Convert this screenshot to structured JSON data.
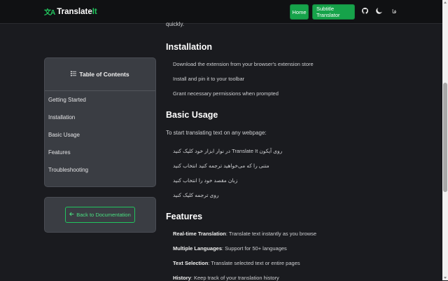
{
  "navbar": {
    "brand_icon": "文A",
    "brand_prefix": "Translate",
    "brand_suffix": "It",
    "home_label": "Home",
    "subtitle_label": "Subtitle Translator",
    "github_icon": "github-icon",
    "theme_icon": "moon-icon",
    "language_label": "فا"
  },
  "toc": {
    "title": "Table of Contents",
    "items": [
      "Getting Started",
      "Installation",
      "Basic Usage",
      "Features",
      "Troubleshooting"
    ]
  },
  "back_label": "Back to Documentation",
  "content": {
    "partial_text": "quickly.",
    "installation": {
      "heading": "Installation",
      "steps": [
        "Download the extension from your browser's extension store",
        "Install and pin it to your toolbar",
        "Grant necessary permissions when prompted"
      ]
    },
    "basic_usage": {
      "heading": "Basic Usage",
      "intro": "To start translating text on any webpage:",
      "steps": [
        "روی آیکون Translate It در نوار ابزار خود کلیک کنید",
        "متنی را که می‌خواهید ترجمه کنید انتخاب کنید",
        "زبان مقصد خود را انتخاب کنید",
        "روی ترجمه کلیک کنید"
      ]
    },
    "features": {
      "heading": "Features",
      "items": [
        {
          "name": "Real-time Translation",
          "desc": ": Translate text instantly as you browse"
        },
        {
          "name": "Multiple Languages",
          "desc": ": Support for 50+ languages"
        },
        {
          "name": "Text Selection",
          "desc": ": Translate selected text or entire pages"
        },
        {
          "name": "History",
          "desc": ": Keep track of your translation history"
        }
      ]
    }
  },
  "colors": {
    "accent": "#22c55e",
    "background": "#1a1b1f",
    "card": "#3a3d43"
  }
}
